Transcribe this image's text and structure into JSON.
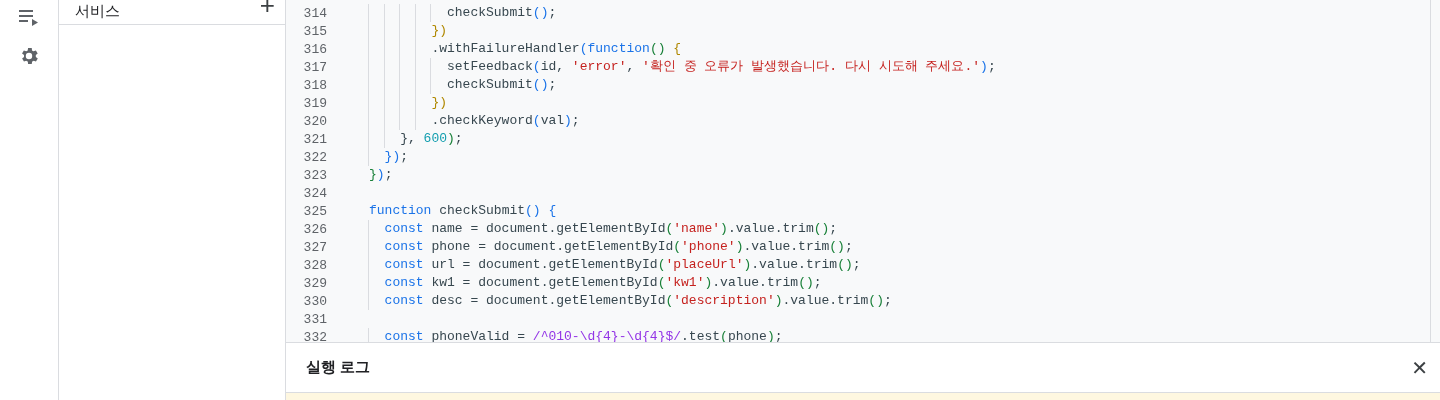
{
  "rail": {
    "items": [
      {
        "kind": "playlist"
      },
      {
        "kind": "settings"
      }
    ]
  },
  "files_panel": {
    "header": {
      "label": "서비스",
      "add": "+"
    }
  },
  "editor": {
    "lines": [
      {
        "number": "314",
        "tokens": [
          {
            "t": "          checkSubmit",
            "kind": "plain"
          },
          {
            "t": "()",
            "kind": "p1"
          },
          {
            "t": ";",
            "kind": "plain"
          }
        ]
      },
      {
        "number": "315",
        "tokens": [
          {
            "t": "        })",
            "kind": "p3"
          }
        ]
      },
      {
        "number": "316",
        "tokens": [
          {
            "t": "        .withFailureHandler",
            "kind": "plain"
          },
          {
            "t": "(",
            "kind": "p1"
          },
          {
            "t": "function",
            "kind": "kw"
          },
          {
            "t": "()",
            "kind": "p2"
          },
          {
            "t": " {",
            "kind": "p3"
          }
        ]
      },
      {
        "number": "317",
        "tokens": [
          {
            "t": "          setFeedback",
            "kind": "plain"
          },
          {
            "t": "(",
            "kind": "p1"
          },
          {
            "t": "id, ",
            "kind": "plain"
          },
          {
            "t": "'error'",
            "kind": "str"
          },
          {
            "t": ", ",
            "kind": "plain"
          },
          {
            "t": "'확인 중 오류가 발생했습니다. 다시 시도해 주세요.'",
            "kind": "str"
          },
          {
            "t": ")",
            "kind": "p1"
          },
          {
            "t": ";",
            "kind": "plain"
          }
        ]
      },
      {
        "number": "318",
        "tokens": [
          {
            "t": "          checkSubmit",
            "kind": "plain"
          },
          {
            "t": "()",
            "kind": "p1"
          },
          {
            "t": ";",
            "kind": "plain"
          }
        ]
      },
      {
        "number": "319",
        "tokens": [
          {
            "t": "        })",
            "kind": "p3"
          }
        ]
      },
      {
        "number": "320",
        "tokens": [
          {
            "t": "        .checkKeyword",
            "kind": "plain"
          },
          {
            "t": "(",
            "kind": "p1"
          },
          {
            "t": "val",
            "kind": "plain"
          },
          {
            "t": ")",
            "kind": "p1"
          },
          {
            "t": ";",
            "kind": "plain"
          }
        ]
      },
      {
        "number": "321",
        "tokens": [
          {
            "t": "    }, ",
            "kind": "plain"
          },
          {
            "t": "600",
            "kind": "num"
          },
          {
            "t": ")",
            "kind": "p2"
          },
          {
            "t": ";",
            "kind": "plain"
          }
        ]
      },
      {
        "number": "322",
        "tokens": [
          {
            "t": "  })",
            "kind": "p1"
          },
          {
            "t": ";",
            "kind": "plain"
          }
        ]
      },
      {
        "number": "323",
        "tokens": [
          {
            "t": "}",
            "kind": "p2"
          },
          {
            "t": ")",
            "kind": "p1"
          },
          {
            "t": ";",
            "kind": "plain"
          }
        ]
      },
      {
        "number": "324"
      },
      {
        "number": "325",
        "tokens": [
          {
            "t": "function",
            "kind": "kw"
          },
          {
            "t": " checkSubmit",
            "kind": "plain"
          },
          {
            "t": "()",
            "kind": "p1"
          },
          {
            "t": " {",
            "kind": "p1"
          }
        ]
      },
      {
        "number": "326",
        "tokens": [
          {
            "t": "  const",
            "kind": "kw"
          },
          {
            "t": " name = document.getElementById",
            "kind": "plain"
          },
          {
            "t": "(",
            "kind": "p2"
          },
          {
            "t": "'name'",
            "kind": "str"
          },
          {
            "t": ")",
            "kind": "p2"
          },
          {
            "t": ".value.trim",
            "kind": "plain"
          },
          {
            "t": "()",
            "kind": "p2"
          },
          {
            "t": ";",
            "kind": "plain"
          }
        ]
      },
      {
        "number": "327",
        "tokens": [
          {
            "t": "  const",
            "kind": "kw"
          },
          {
            "t": " phone = document.getElementById",
            "kind": "plain"
          },
          {
            "t": "(",
            "kind": "p2"
          },
          {
            "t": "'phone'",
            "kind": "str"
          },
          {
            "t": ")",
            "kind": "p2"
          },
          {
            "t": ".value.trim",
            "kind": "plain"
          },
          {
            "t": "()",
            "kind": "p2"
          },
          {
            "t": ";",
            "kind": "plain"
          }
        ]
      },
      {
        "number": "328",
        "tokens": [
          {
            "t": "  const",
            "kind": "kw"
          },
          {
            "t": " url = document.getElementById",
            "kind": "plain"
          },
          {
            "t": "(",
            "kind": "p2"
          },
          {
            "t": "'placeUrl'",
            "kind": "str"
          },
          {
            "t": ")",
            "kind": "p2"
          },
          {
            "t": ".value.trim",
            "kind": "plain"
          },
          {
            "t": "()",
            "kind": "p2"
          },
          {
            "t": ";",
            "kind": "plain"
          }
        ]
      },
      {
        "number": "329",
        "tokens": [
          {
            "t": "  const",
            "kind": "kw"
          },
          {
            "t": " kw1 = document.getElementById",
            "kind": "plain"
          },
          {
            "t": "(",
            "kind": "p2"
          },
          {
            "t": "'kw1'",
            "kind": "str"
          },
          {
            "t": ")",
            "kind": "p2"
          },
          {
            "t": ".value.trim",
            "kind": "plain"
          },
          {
            "t": "()",
            "kind": "p2"
          },
          {
            "t": ";",
            "kind": "plain"
          }
        ]
      },
      {
        "number": "330",
        "tokens": [
          {
            "t": "  const",
            "kind": "kw"
          },
          {
            "t": " desc = document.getElementById",
            "kind": "plain"
          },
          {
            "t": "(",
            "kind": "p2"
          },
          {
            "t": "'description'",
            "kind": "str"
          },
          {
            "t": ")",
            "kind": "p2"
          },
          {
            "t": ".value.trim",
            "kind": "plain"
          },
          {
            "t": "()",
            "kind": "p2"
          },
          {
            "t": ";",
            "kind": "plain"
          }
        ]
      },
      {
        "number": "331"
      },
      {
        "number": "332",
        "tokens": [
          {
            "t": "  const",
            "kind": "kw"
          },
          {
            "t": " phoneValid = ",
            "kind": "plain"
          },
          {
            "t": "/^010-\\d{4}-\\d{4}$/",
            "kind": "re"
          },
          {
            "t": ".test",
            "kind": "plain"
          },
          {
            "t": "(",
            "kind": "p2"
          },
          {
            "t": "phone",
            "kind": "plain"
          },
          {
            "t": ")",
            "kind": "p2"
          },
          {
            "t": ";",
            "kind": "plain"
          }
        ]
      }
    ]
  },
  "log_panel": {
    "title": "실행 로그",
    "close": "✕"
  }
}
